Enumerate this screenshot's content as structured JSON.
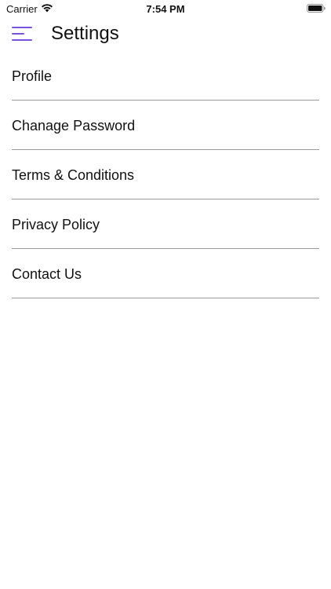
{
  "status_bar": {
    "carrier": "Carrier",
    "time": "7:54 PM",
    "wifi_icon": "wifi-icon",
    "battery_icon": "battery-icon"
  },
  "header": {
    "title": "Settings",
    "menu_icon": "hamburger-menu-icon",
    "accent_color": "#7b4fe0"
  },
  "settings": {
    "items": [
      {
        "label": "Profile"
      },
      {
        "label": "Chanage Password"
      },
      {
        "label": "Terms & Conditions"
      },
      {
        "label": "Privacy Policy"
      },
      {
        "label": "Contact Us"
      }
    ]
  },
  "colors": {
    "background": "#ffffff",
    "text": "#111111",
    "divider": "#9a9a9a"
  }
}
